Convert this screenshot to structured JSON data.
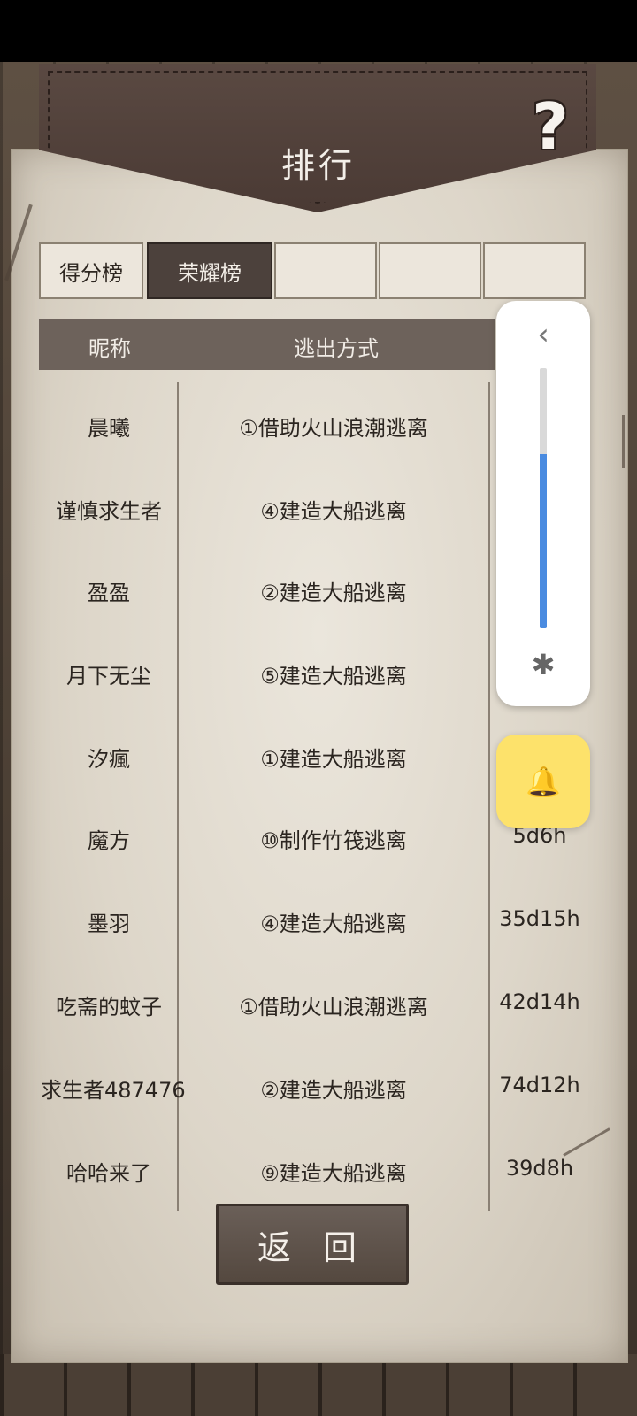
{
  "title": "排行",
  "help_icon": "?",
  "tabs": [
    {
      "label": "得分榜",
      "active": false
    },
    {
      "label": "荣耀榜",
      "active": true
    },
    {
      "label": "",
      "active": false
    },
    {
      "label": "",
      "active": false
    },
    {
      "label": "",
      "active": false
    }
  ],
  "table": {
    "headers": [
      "昵称",
      "逃出方式"
    ],
    "rows": [
      {
        "name": "晨曦",
        "method": "①借助火山浪潮逃离",
        "time": ""
      },
      {
        "name": "谨慎求生者",
        "method": "④建造大船逃离",
        "time": ""
      },
      {
        "name": "盈盈",
        "method": "②建造大船逃离",
        "time": ""
      },
      {
        "name": "月下无尘",
        "method": "⑤建造大船逃离",
        "time": ""
      },
      {
        "name": "汐瘋",
        "method": "①建造大船逃离",
        "time": ""
      },
      {
        "name": "魔方",
        "method": "⑩制作竹筏逃离",
        "time": "5d6h"
      },
      {
        "name": "墨羽",
        "method": "④建造大船逃离",
        "time": "35d15h"
      },
      {
        "name": "吃斋的蚊子",
        "method": "①借助火山浪潮逃离",
        "time": "42d14h"
      },
      {
        "name": "求生者487476",
        "method": "②建造大船逃离",
        "time": "74d12h"
      },
      {
        "name": "哈哈来了",
        "method": "⑨建造大船逃离",
        "time": "39d8h"
      }
    ]
  },
  "back_button": "返 回",
  "volume_panel": {
    "chevron": "‹",
    "level": 0.67,
    "bluetooth_icon": "✱",
    "accent": "#4a8be0"
  },
  "ringer_button": {
    "icon": "bell-icon",
    "glyph": "🔔",
    "color": "#fde26b"
  }
}
